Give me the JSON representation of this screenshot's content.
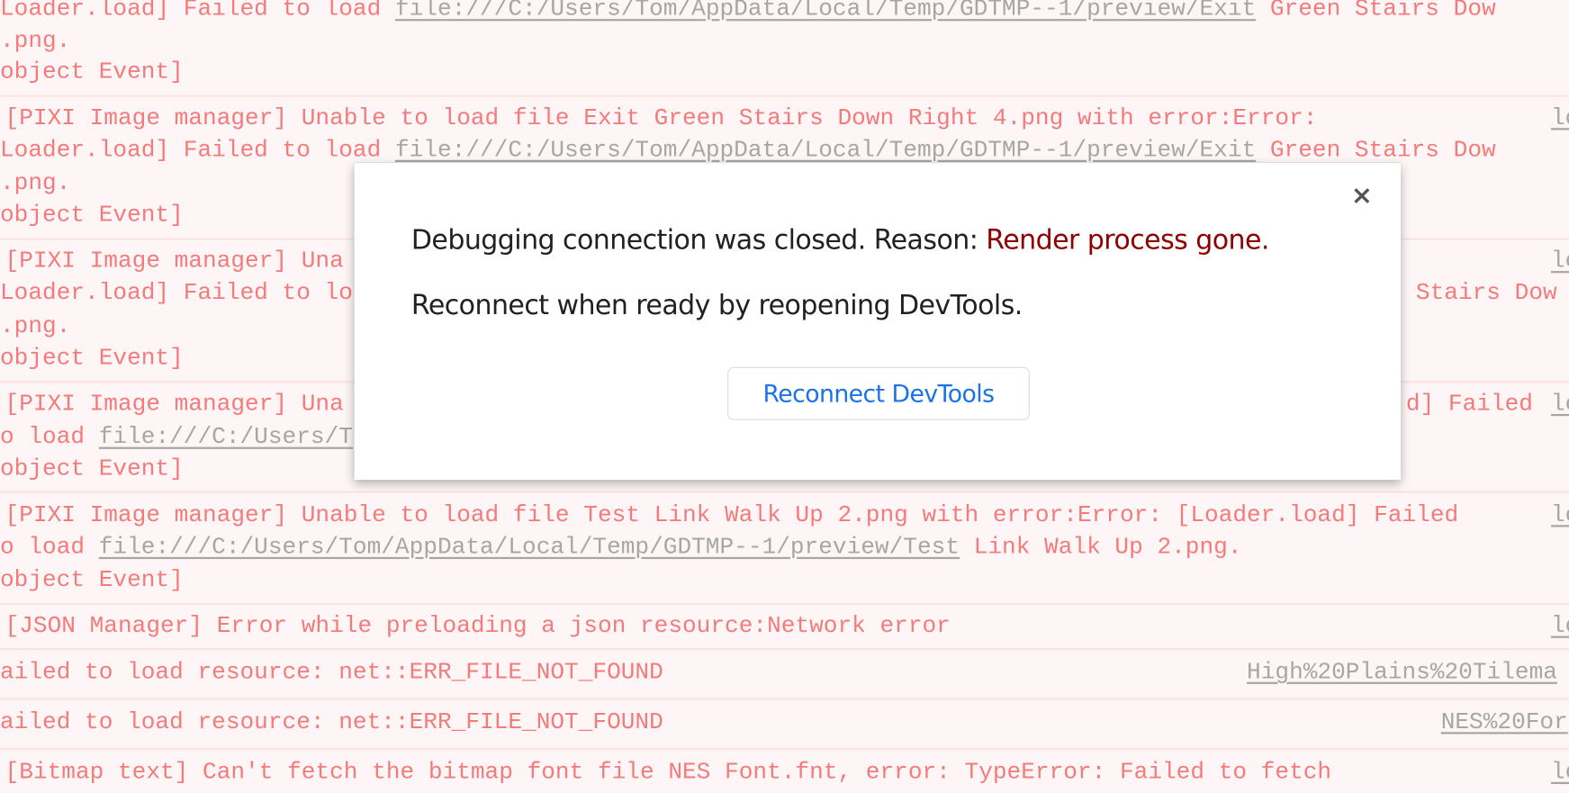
{
  "console": {
    "rows": [
      {
        "lines": [
          {
            "pre": "Loader.load] Failed to load ",
            "link": "file:///C:/Users/Tom/AppData/Local/Temp/GDTMP--1/preview/Exit",
            "post": " Green Stairs Dow"
          },
          {
            "pre": ".png."
          },
          {
            "pre": "object Event]"
          }
        ]
      },
      {
        "lines": [
          {
            "pre": "[PIXI Image manager] Unable to load file Exit Green Stairs Down Right 4.png with error:Error:"
          },
          {
            "pre": "Loader.load] Failed to load ",
            "link": "file:///C:/Users/Tom/AppData/Local/Temp/GDTMP--1/preview/Exit",
            "post": " Green Stairs Dow"
          },
          {
            "pre": ".png."
          },
          {
            "pre": "object Event]"
          }
        ],
        "source": "lo"
      },
      {
        "lines": [
          {
            "pre": "[PIXI Image manager] Una"
          },
          {
            "pre": "Loader.load] Failed to lo",
            "right": "n Stairs Dow"
          },
          {
            "pre": ".png."
          },
          {
            "pre": "object Event]"
          }
        ],
        "source": "lo"
      },
      {
        "lines": [
          {
            "pre": "[PIXI Image manager] Una",
            "right": "d] Failed"
          },
          {
            "pre": "o load ",
            "link": "file:///C:/Users/T"
          },
          {
            "pre": "object Event]"
          }
        ],
        "source": "lo"
      },
      {
        "lines": [
          {
            "pre": "[PIXI Image manager] Unable to load file Test Link Walk Up 2.png with error:Error: [Loader.load] Failed"
          },
          {
            "pre": "o load ",
            "link": "file:///C:/Users/Tom/AppData/Local/Temp/GDTMP--1/preview/Test",
            "post": " Link Walk Up 2.png."
          },
          {
            "pre": "object Event]"
          }
        ],
        "source": "lo"
      },
      {
        "lines": [
          {
            "pre": "[JSON Manager] Error while preloading a json resource:Network error"
          }
        ],
        "source": "lo"
      },
      {
        "lines": [
          {
            "pre": "ailed to load resource: net::ERR_FILE_NOT_FOUND"
          }
        ],
        "source": "High%20Plains%20Tilema"
      },
      {
        "lines": [
          {
            "pre": "ailed to load resource: net::ERR_FILE_NOT_FOUND"
          }
        ],
        "source": "NES%20For"
      },
      {
        "lines": [
          {
            "pre": "[Bitmap text] Can't fetch the bitmap font file NES Font.fnt, error: TypeError: Failed to fetch"
          }
        ],
        "source": "lo"
      }
    ]
  },
  "dialog": {
    "message_prefix": "Debugging connection was closed. Reason: ",
    "reason": "Render process gone.",
    "instruction": "Reconnect when ready by reopening DevTools.",
    "button_label": "Reconnect DevTools",
    "close_icon": "×"
  },
  "colors": {
    "error_text": "#f47b7b",
    "row_background": "#fef6f6",
    "reason": "#8f0000",
    "button_text": "#1a73e8"
  }
}
